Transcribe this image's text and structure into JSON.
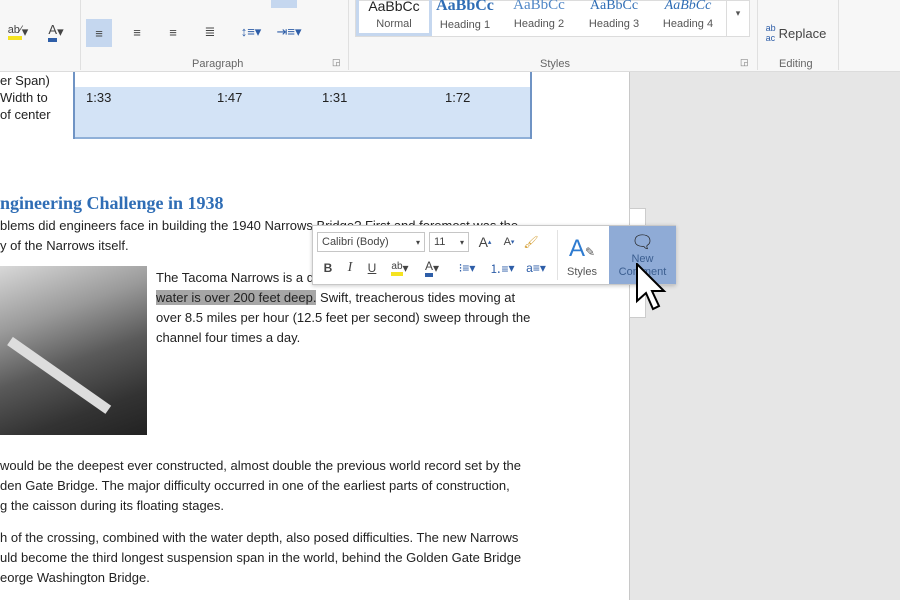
{
  "ribbon": {
    "paragraph_group": "Paragraph",
    "styles_group": "Styles",
    "editing_group": "Editing",
    "replace_label": "Replace",
    "styles": [
      {
        "preview": "AaBbCc",
        "name": "Normal"
      },
      {
        "preview": "AaBbCc",
        "name": "Heading 1"
      },
      {
        "preview": "AaBbCc",
        "name": "Heading 2"
      },
      {
        "preview": "AaBbCc",
        "name": "Heading 3"
      },
      {
        "preview": "AaBbCc",
        "name": "Heading 4"
      }
    ],
    "highlight_color": "#f5e320",
    "font_color": "#2e5ea8"
  },
  "table": {
    "row_label": [
      "er Span)",
      "Width to",
      "of center"
    ],
    "values": [
      "1:33",
      "1:47",
      "1:31",
      "1:72"
    ],
    "shade_color": "#d3e3f6"
  },
  "document": {
    "heading": "ngineering Challenge in 1938",
    "intro": [
      "blems did engineers face in building the 1940 Narrows Bridge? First and foremost was the",
      "y of the Narrows itself."
    ],
    "para1_first": "The Tacoma Narrows is a d",
    "para1_highlight": "water is over 200 feet deep.",
    "para1_rest": " Swift, treacherous tides moving at",
    "para1_lines": [
      "over 8.5 miles per hour (12.5 feet per second) sweep through the",
      "channel four times a day."
    ],
    "para2": [
      "would be the deepest ever constructed, almost double the previous world record set by the",
      "den Gate Bridge. The major difficulty occurred in one of the earliest parts of construction,",
      "g the caisson during its floating stages."
    ],
    "para3": [
      "h of the crossing, combined with the water depth, also posed difficulties. The new Narrows",
      "uld become the third longest suspension span in the world, behind the Golden Gate Bridge",
      "eorge Washington Bridge."
    ]
  },
  "mini_toolbar": {
    "font_name": "Calibri (Body)",
    "font_size": "11",
    "bold": "B",
    "italic": "I",
    "underline": "U",
    "styles_label": "Styles",
    "new_comment_label": "New Comment",
    "active_color": "#8fabd6"
  }
}
